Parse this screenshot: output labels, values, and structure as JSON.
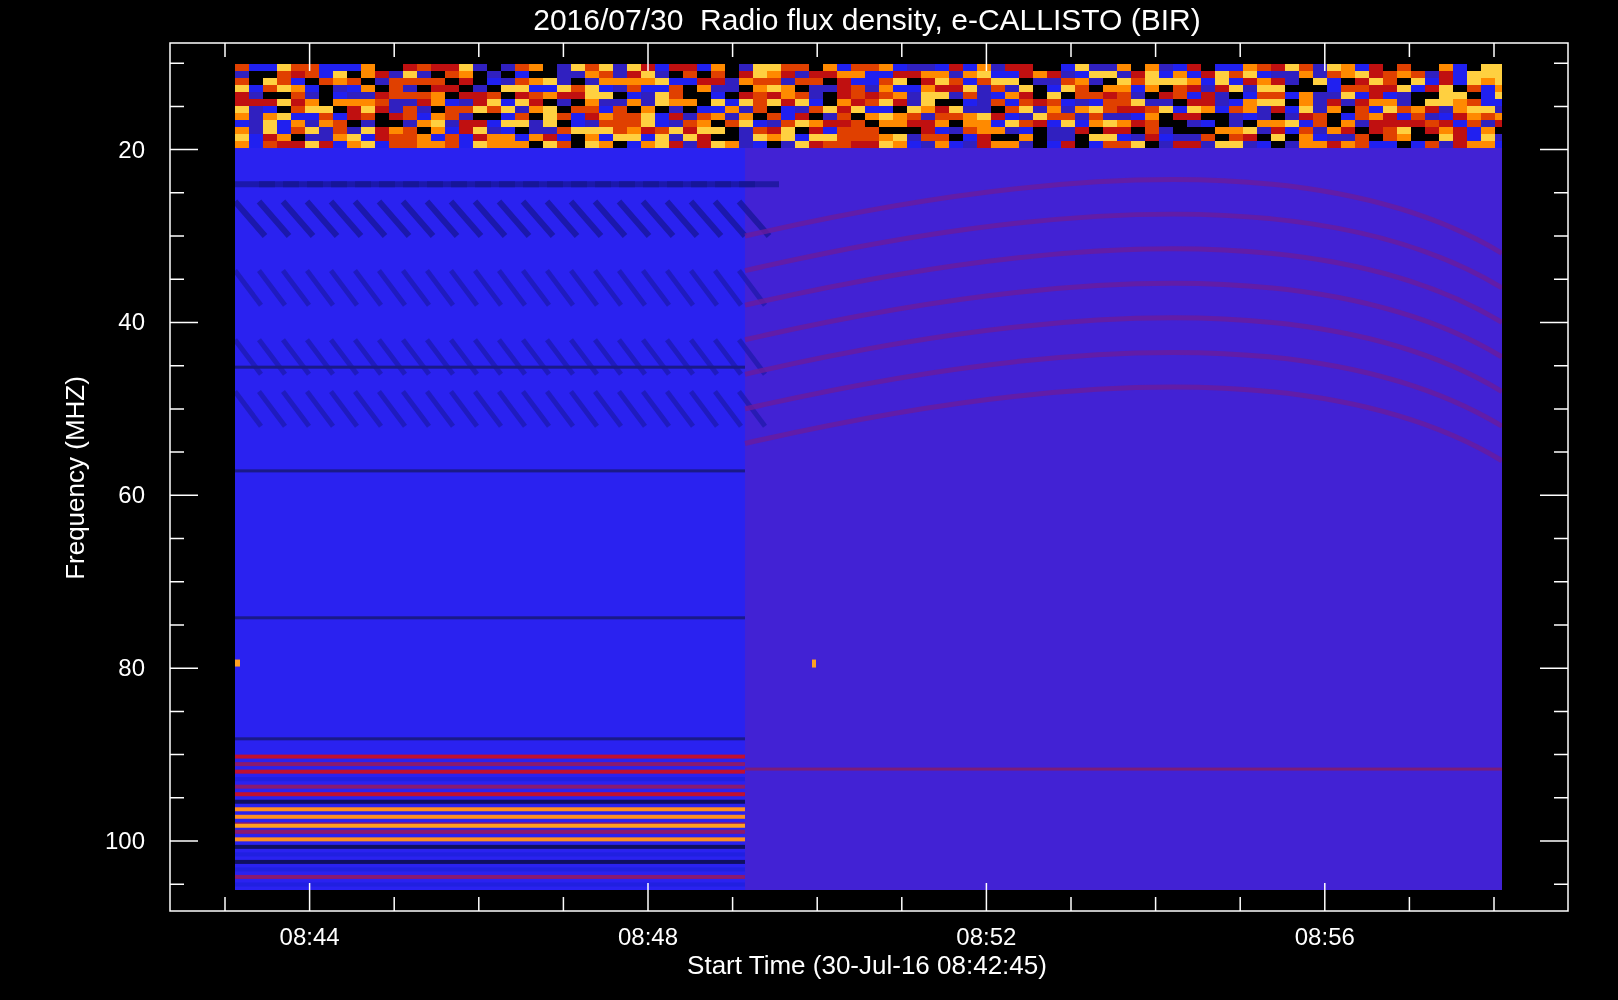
{
  "title": "2016/07/30  Radio flux density, e-CALLISTO (BIR)",
  "y_axis": {
    "label": "Frequency (MHZ)",
    "ticks": [
      "20",
      "40",
      "60",
      "80",
      "100"
    ]
  },
  "x_axis": {
    "label": "Start Time (30-Jul-16 08:42:45)",
    "ticks": [
      "08:44",
      "08:48",
      "08:52",
      "08:56"
    ]
  }
}
